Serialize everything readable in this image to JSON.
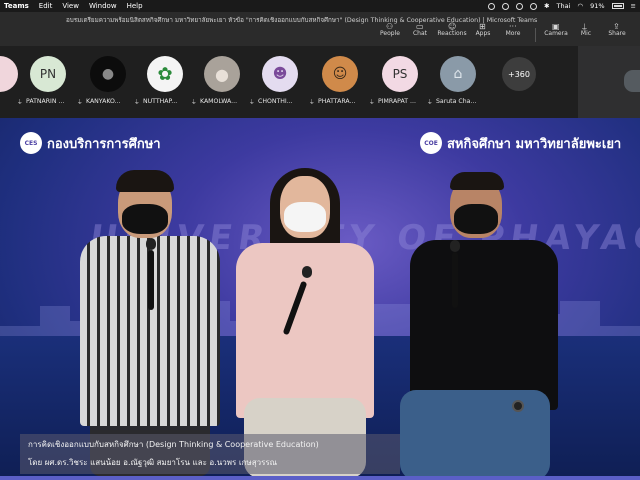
{
  "menubar": {
    "app_name": "Teams",
    "items": [
      "Edit",
      "View",
      "Window",
      "Help"
    ],
    "input_source": "Thai",
    "wifi": "91%",
    "battery_percent": "91%"
  },
  "topbar": {
    "meeting_title": "อบรมเตรียมความพร้อมนิสิตสหกิจศึกษา มหาวิทยาลัยพะเยา หัวข้อ \"การคิดเชิงออกแบบกับสหกิจศึกษา\" (Design Thinking & Cooperative Education) | Microsoft Teams",
    "buttons": [
      {
        "label": "People",
        "icon": "people-icon"
      },
      {
        "label": "Chat",
        "icon": "chat-icon"
      },
      {
        "label": "Reactions",
        "icon": "reactions-icon"
      },
      {
        "label": "Apps",
        "icon": "apps-icon"
      },
      {
        "label": "More",
        "icon": "more-icon"
      },
      {
        "label": "Camera",
        "icon": "camera-icon"
      },
      {
        "label": "Mic",
        "icon": "mic-icon"
      },
      {
        "label": "Share",
        "icon": "share-icon"
      }
    ]
  },
  "participants": [
    {
      "name": "PATNARIN ...",
      "initials": "PN",
      "color": "#d8e8d4"
    },
    {
      "name": "KANYAKO...",
      "initials": "",
      "color": "#0c0c0c"
    },
    {
      "name": "NUTTHAP...",
      "initials": "",
      "color": "#f4f4f4"
    },
    {
      "name": "KAMOLWA...",
      "initials": "",
      "color": "#a9a29a"
    },
    {
      "name": "CHONTHI...",
      "initials": "",
      "color": "#e4dcf0"
    },
    {
      "name": "PHATTARA...",
      "initials": "",
      "color": "#d08a4a"
    },
    {
      "name": "PIMRAPAT ...",
      "initials": "PS",
      "color": "#f2d9e4"
    },
    {
      "name": "Saruta Cha...",
      "initials": "",
      "color": "#8a9aa8"
    }
  ],
  "more_participants": "+360",
  "stage": {
    "logo_left_badge": "CES",
    "logo_left_text": "กองบริการการศึกษา",
    "logo_right_badge": "COE",
    "logo_right_text": "สหกิจศึกษา มหาวิทยาลัยพะเยา",
    "watermark": "UNIVERSITY OF PHAYAO",
    "caption_line1": "การคิดเชิงออกแบบกับสหกิจศึกษา (Design Thinking & Cooperative Education)",
    "caption_line2": "โดย ผศ.ดร.วิชระ แสนน้อย อ.ณัฐวุฒิ สมยาโรน และ อ.นวพร เกษสุวรรณ"
  },
  "colors": {
    "accent": "#5b5fc7",
    "stage_purple": "#3d3aa0"
  }
}
